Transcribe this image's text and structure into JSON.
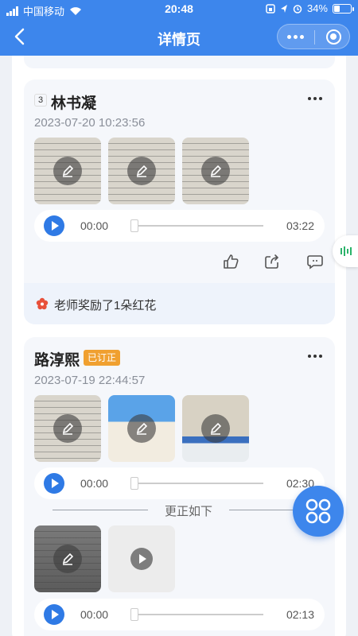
{
  "status_bar": {
    "carrier": "中国移动",
    "time": "20:48",
    "battery": "34%",
    "battery_level": 0.34
  },
  "nav": {
    "title": "详情页"
  },
  "submissions": [
    {
      "index": "3",
      "name": "林书凝",
      "date": "2023-07-20 10:23:56",
      "audio": {
        "current": "00:00",
        "duration": "03:22"
      },
      "reward_text": "老师奖励了1朵红花"
    },
    {
      "name": "路淳熙",
      "badge": "已订正",
      "date": "2023-07-19 22:44:57",
      "audio": {
        "current": "00:00",
        "duration": "02:30"
      },
      "correction_label": "更正如下",
      "correction_audio": {
        "current": "00:00",
        "duration": "02:13"
      }
    }
  ],
  "icons": {
    "back": "chevron-left-icon",
    "more": "more-dots-icon",
    "edit": "pencil-icon",
    "like": "thumbs-up-icon",
    "share": "share-icon",
    "comment": "comment-icon",
    "flower": "flower-icon",
    "fab": "grid-menu-icon",
    "mic": "voice-wave-icon"
  },
  "colors": {
    "primary": "#3d86ec",
    "badge": "#f0a030",
    "flower": "#e8503a",
    "voice": "#2bb36a"
  }
}
